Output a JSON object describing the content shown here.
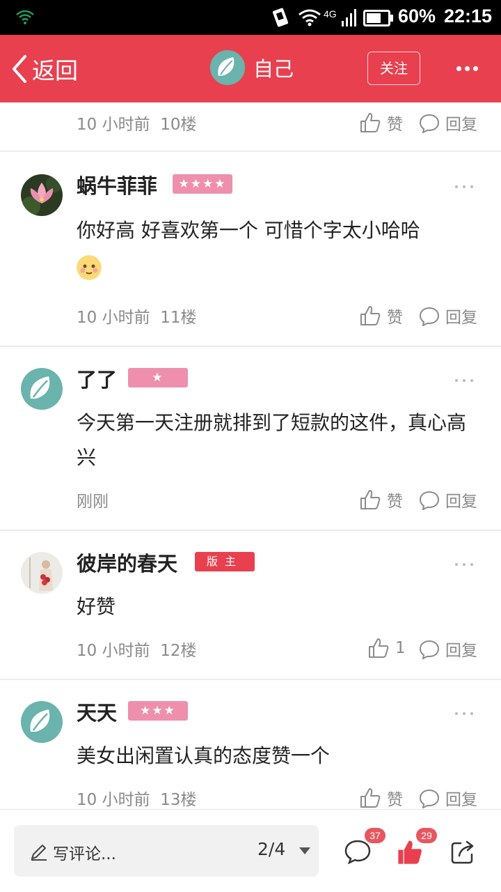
{
  "status_bar": {
    "network": "4G",
    "battery": "60%",
    "time": "22:15"
  },
  "header": {
    "back_label": "返回",
    "title": "自己",
    "follow_label": "关注",
    "accent_color": "#e8404f"
  },
  "top_meta": {
    "time": "10 小时前",
    "floor": "10楼",
    "like_label": "赞",
    "reply_label": "回复"
  },
  "comments": [
    {
      "username": "蜗牛菲菲",
      "badge": "★★★★",
      "text": "你好高 好喜欢第一个 可惜个字太小哈哈",
      "time": "10 小时前",
      "floor": "11楼",
      "like_label": "赞",
      "reply_label": "回复"
    },
    {
      "username": "了了",
      "badge": "★",
      "text": "今天第一天注册就排到了短款的这件，真心高兴",
      "time": "刚刚",
      "floor": "",
      "like_label": "赞",
      "reply_label": "回复"
    },
    {
      "username": "彼岸的春天",
      "badge": "版主",
      "text": "好赞",
      "time": "10 小时前",
      "floor": "12楼",
      "like_label": "1",
      "reply_label": "回复"
    },
    {
      "username": "天天",
      "badge": "★★★",
      "text": "美女出闲置认真的态度赞一个",
      "time": "10 小时前",
      "floor": "13楼",
      "like_label": "赞",
      "reply_label": "回复"
    }
  ],
  "bottom_bar": {
    "compose_placeholder": "写评论...",
    "page_indicator": "2/4",
    "comment_count": "37",
    "like_count": "29"
  }
}
